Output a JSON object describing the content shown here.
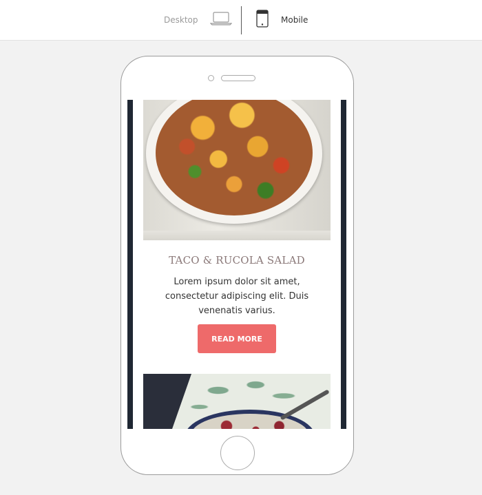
{
  "toolbar": {
    "desktop_label": "Desktop",
    "mobile_label": "Mobile",
    "desktop_icon": "laptop-icon",
    "mobile_icon": "mobile-phone-icon",
    "selected": "Mobile"
  },
  "article": {
    "title": "TACO & RUCOLA SALAD",
    "text": "Lorem ipsum dolor sit amet, consectetur adipiscing elit. Duis venenatis varius.",
    "button_label": "READ MORE"
  },
  "colors": {
    "button": "#ee6a6a",
    "title": "#8a7878",
    "email_border": "#1f2733",
    "background": "#f2f2f2"
  }
}
